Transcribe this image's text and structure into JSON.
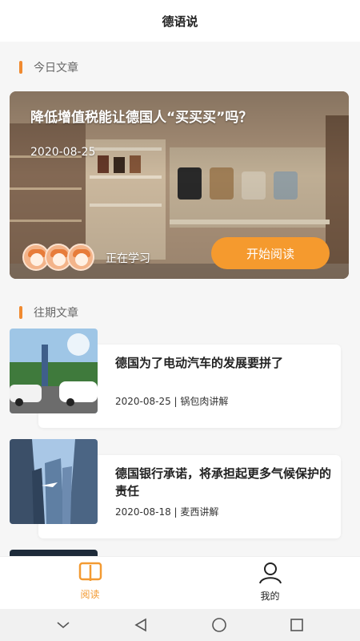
{
  "header": {
    "title": "德语说"
  },
  "today": {
    "section_label": "今日文章",
    "headline": "降低增值税能让德国人“买买买”吗？",
    "date": "2020-08-25",
    "studying_label": "正在学习",
    "start_label": "开始阅读"
  },
  "past": {
    "section_label": "往期文章",
    "articles": [
      {
        "title": "德国为了电动汽车的发展要拼了",
        "meta": "2020-08-25 |  锅包肉讲解"
      },
      {
        "title": "德国银行承诺，将承担起更多气候保护的责任",
        "meta": "2020-08-18 |  麦西讲解"
      }
    ]
  },
  "tabs": [
    {
      "label": "阅读",
      "icon": "book-icon",
      "active": true
    },
    {
      "label": "我的",
      "icon": "person-icon",
      "active": false
    }
  ],
  "colors": {
    "accent": "#f39a32",
    "section_bar": "#f08a30"
  }
}
